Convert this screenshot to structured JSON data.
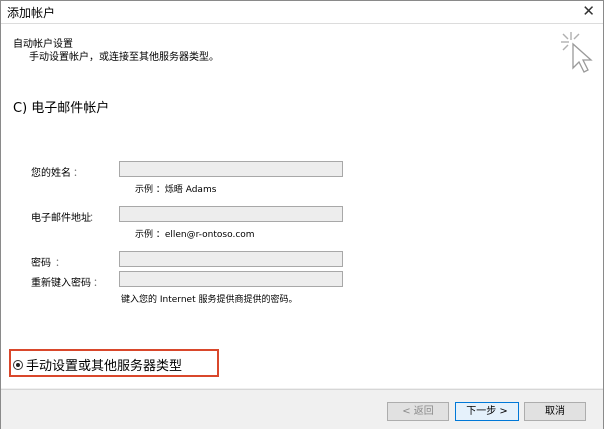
{
  "window": {
    "title": "添加帐户",
    "close_glyph": "✕"
  },
  "header": {
    "title": "自动帐户设置",
    "subtitle": "手动设置帐户，或连接至其他服务器类型。",
    "icon": "magic-wand-cursor-icon"
  },
  "option_top": {
    "label": "C) 电子邮件帐户"
  },
  "form": {
    "name_label": "您的姓名",
    "name_colon": "：",
    "name_value": "",
    "name_example": "示例 ：烁晤 Adams",
    "email_label": "电子邮件地址",
    "email_colon": "：",
    "email_value": "",
    "email_example": "示例 ：ellen@r-ontoso.com",
    "password_label": "密码",
    "password_colon": "：",
    "password_value": "",
    "retype_label": "重新键入密码",
    "retype_colon": "：",
    "retype_value": "",
    "hint": "键入您的 Internet 服务提供商提供的密码。"
  },
  "option_manual": {
    "label": "手动设置或其他服务器类型",
    "selected": true,
    "highlight_color": "#d9472b"
  },
  "buttons": {
    "back": "< 返回",
    "next": "下一步 >",
    "cancel": "取消"
  }
}
